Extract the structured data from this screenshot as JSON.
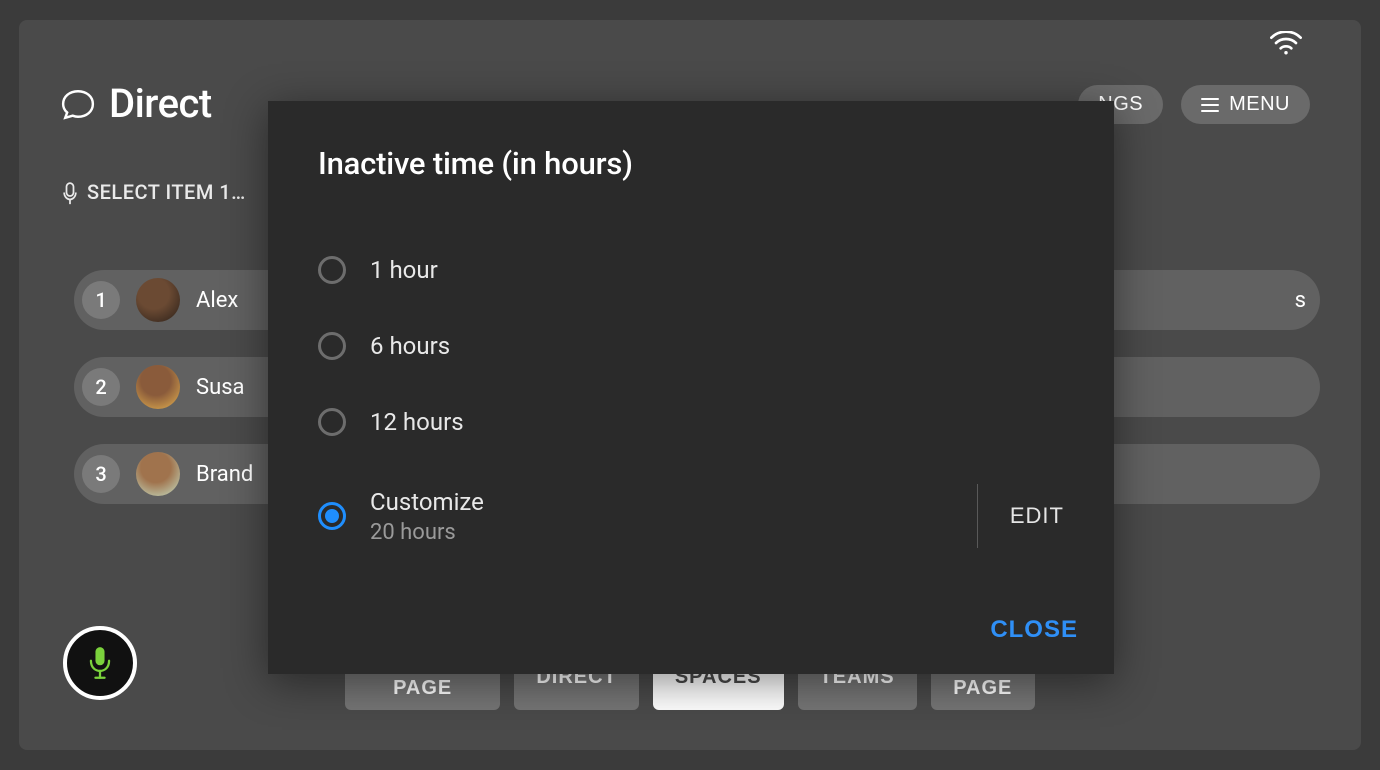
{
  "header": {
    "title": "Direct",
    "settings_label": "NGS",
    "menu_label": "MENU"
  },
  "voice_hint": "SELECT ITEM 1…",
  "list": {
    "items": [
      {
        "num": "1",
        "name": "Alex ",
        "avatar_class": "a1"
      },
      {
        "num": "2",
        "name": "Susa",
        "avatar_class": "a2"
      },
      {
        "num": "3",
        "name": "Brand",
        "avatar_class": "a3"
      }
    ],
    "right_visible_text": "s"
  },
  "bottom_nav": {
    "items": [
      {
        "label": "PREVIOUS PAGE",
        "active": false
      },
      {
        "label": "DIRECT",
        "active": false
      },
      {
        "label": "SPACES",
        "active": true
      },
      {
        "label": "TEAMS",
        "active": false
      },
      {
        "label": "NEXT PAGE",
        "active": false
      }
    ]
  },
  "dialog": {
    "title": "Inactive time (in hours)",
    "options": [
      {
        "label": "1 hour",
        "selected": false
      },
      {
        "label": "6 hours",
        "selected": false
      },
      {
        "label": "12 hours",
        "selected": false
      }
    ],
    "customize": {
      "label": "Customize",
      "sub": "20 hours",
      "selected": true,
      "edit_label": "EDIT"
    },
    "close_label": "CLOSE"
  }
}
